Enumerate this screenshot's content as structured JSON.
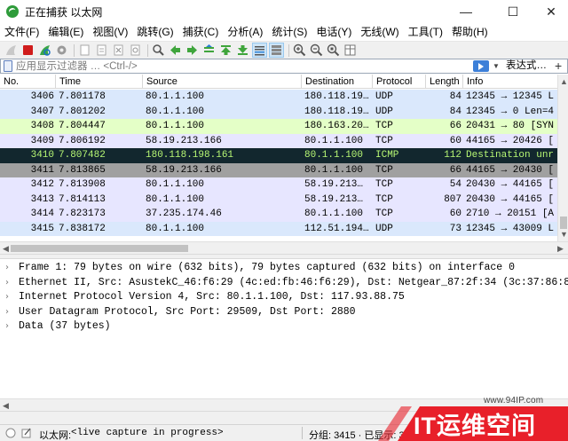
{
  "window": {
    "title": "正在捕获 以太网",
    "minimize": "—",
    "maximize": "☐",
    "close": "✕"
  },
  "menu": [
    "文件(F)",
    "编辑(E)",
    "视图(V)",
    "跳转(G)",
    "捕获(C)",
    "分析(A)",
    "统计(S)",
    "电话(Y)",
    "无线(W)",
    "工具(T)",
    "帮助(H)"
  ],
  "toolbar": {
    "icons": [
      "shark-fin-start-icon",
      "stop-capture-icon",
      "restart-capture-icon",
      "capture-options-icon",
      "open-file-icon",
      "save-file-icon",
      "close-file-icon",
      "reload-file-icon",
      "find-packet-icon",
      "go-back-icon",
      "go-forward-icon",
      "go-to-packet-icon",
      "go-first-icon",
      "go-last-icon",
      "autoscroll-icon",
      "colorize-icon",
      "zoom-in-icon",
      "zoom-out-icon",
      "zoom-normal-icon",
      "resize-columns-icon"
    ]
  },
  "filter": {
    "placeholder": "应用显示过滤器 … <Ctrl-/>",
    "expression_label": "表达式…",
    "add_label": "+"
  },
  "columns": [
    "No.",
    "Time",
    "Source",
    "Destination",
    "Protocol",
    "Length",
    "Info"
  ],
  "packets": [
    {
      "no": "3406",
      "time": "7.801178",
      "src": "80.1.1.100",
      "dst": "180.118.19…",
      "proto": "UDP",
      "len": "84",
      "info": "12345 → 12345 L",
      "bg": "#dae8fc",
      "fg": "#000000"
    },
    {
      "no": "3407",
      "time": "7.801202",
      "src": "80.1.1.100",
      "dst": "180.118.19…",
      "proto": "UDP",
      "len": "84",
      "info": "12345 → 0 Len=4",
      "bg": "#dae8fc",
      "fg": "#000000"
    },
    {
      "no": "3408",
      "time": "7.804447",
      "src": "80.1.1.100",
      "dst": "180.163.20…",
      "proto": "TCP",
      "len": "66",
      "info": "20431 → 80 [SYN",
      "bg": "#e4ffc7",
      "fg": "#000000"
    },
    {
      "no": "3409",
      "time": "7.806192",
      "src": "58.19.213.166",
      "dst": "80.1.1.100",
      "proto": "TCP",
      "len": "60",
      "info": "44165 → 20426 [",
      "bg": "#e7e6ff",
      "fg": "#000000"
    },
    {
      "no": "3410",
      "time": "7.807482",
      "src": "180.118.198.161",
      "dst": "80.1.1.100",
      "proto": "ICMP",
      "len": "112",
      "info": "Destination unr",
      "bg": "#12272e",
      "fg": "#b7f774"
    },
    {
      "no": "3411",
      "time": "7.813865",
      "src": "58.19.213.166",
      "dst": "80.1.1.100",
      "proto": "TCP",
      "len": "66",
      "info": "44165 → 20430 [",
      "bg": "#a0a0a0",
      "fg": "#000000"
    },
    {
      "no": "3412",
      "time": "7.813908",
      "src": "80.1.1.100",
      "dst": "58.19.213…",
      "proto": "TCP",
      "len": "54",
      "info": "20430 → 44165 [",
      "bg": "#e7e6ff",
      "fg": "#000000"
    },
    {
      "no": "3413",
      "time": "7.814113",
      "src": "80.1.1.100",
      "dst": "58.19.213…",
      "proto": "TCP",
      "len": "807",
      "info": "20430 → 44165 [",
      "bg": "#e7e6ff",
      "fg": "#000000"
    },
    {
      "no": "3414",
      "time": "7.823173",
      "src": "37.235.174.46",
      "dst": "80.1.1.100",
      "proto": "TCP",
      "len": "60",
      "info": "2710 → 20151 [A",
      "bg": "#e7e6ff",
      "fg": "#000000"
    },
    {
      "no": "3415",
      "time": "7.838172",
      "src": "80.1.1.100",
      "dst": "112.51.194…",
      "proto": "UDP",
      "len": "73",
      "info": "12345 → 43009 L",
      "bg": "#dae8fc",
      "fg": "#000000"
    }
  ],
  "details": [
    "Frame 1: 79 bytes on wire (632 bits), 79 bytes captured (632 bits) on interface 0",
    "Ethernet II, Src: AsustekC_46:f6:29 (4c:ed:fb:46:f6:29), Dst: Netgear_87:2f:34 (3c:37:86:87",
    "Internet Protocol Version 4, Src: 80.1.1.100, Dst: 117.93.88.75",
    "User Datagram Protocol, Src Port: 29509, Dst Port: 2880",
    "Data (37 bytes)"
  ],
  "expander": "›",
  "status": {
    "interface": "以太网:",
    "capture_state": "<live capture in progress>",
    "packets": "分组: 3415 · 已显示: 3415"
  },
  "watermark": {
    "url": "www.94IP.com",
    "text": "IT运维空间"
  },
  "colors": {
    "udp_row": "#dae8fc",
    "tcp_row": "#e7e6ff",
    "tcp_syn_row": "#e4ffc7",
    "icmp_error_row": "#12272e",
    "tcp_problem_row": "#a0a0a0",
    "watermark_red": "#e8202a"
  }
}
